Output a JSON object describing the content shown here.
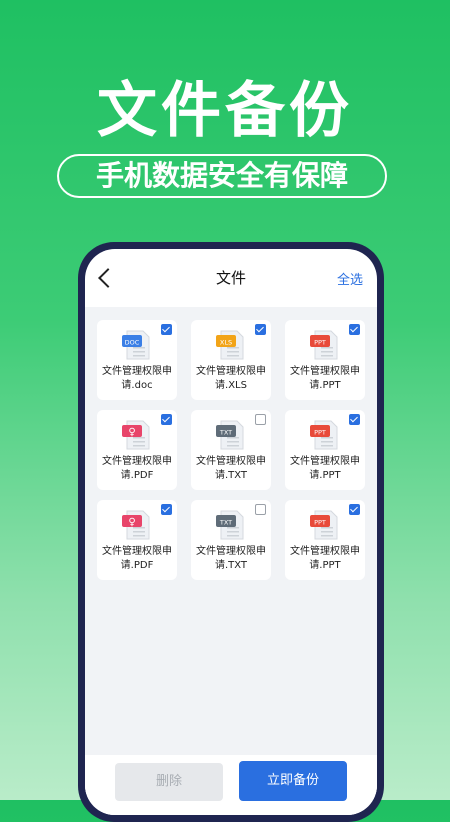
{
  "hero": {
    "title": "文件备份",
    "subtitle": "手机数据安全有保障"
  },
  "navbar": {
    "title": "文件",
    "select_all": "全选"
  },
  "files": [
    {
      "type": "DOC",
      "name": "文件管理权限申请.doc",
      "checked": true,
      "color": "#3b7fe6"
    },
    {
      "type": "XLS",
      "name": "文件管理权限申请.XLS",
      "checked": true,
      "color": "#f2a418"
    },
    {
      "type": "PPT",
      "name": "文件管理权限申请.PPT",
      "checked": true,
      "color": "#e84a3a"
    },
    {
      "type": "PDF",
      "name": "文件管理权限申请.PDF",
      "checked": true,
      "color": "#e8456a"
    },
    {
      "type": "TXT",
      "name": "文件管理权限申请.TXT",
      "checked": false,
      "color": "#5f6c78"
    },
    {
      "type": "PPT",
      "name": "文件管理权限申请.PPT",
      "checked": true,
      "color": "#e84a3a"
    },
    {
      "type": "PDF",
      "name": "文件管理权限申请.PDF",
      "checked": true,
      "color": "#e8456a"
    },
    {
      "type": "TXT",
      "name": "文件管理权限申请.TXT",
      "checked": false,
      "color": "#5f6c78"
    },
    {
      "type": "PPT",
      "name": "文件管理权限申请.PPT",
      "checked": true,
      "color": "#e84a3a"
    }
  ],
  "actions": {
    "delete": "删除",
    "backup": "立即备份"
  },
  "colors": {
    "brand_green": "#1fc062",
    "accent_blue": "#2a6fe0"
  }
}
